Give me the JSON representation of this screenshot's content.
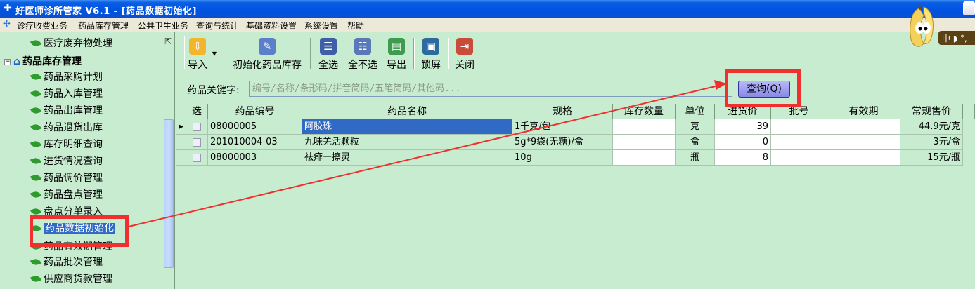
{
  "window": {
    "title": "好医师诊所管家 V6.1 - [药品数据初始化]"
  },
  "menu": {
    "items": [
      "诊疗收费业务",
      "药品库存管理",
      "公共卫生业务",
      "查询与统计",
      "基础资料设置",
      "系统设置",
      "帮助"
    ]
  },
  "ime": {
    "label": "中"
  },
  "sidebar": {
    "group_label": "药品库存管理",
    "items": [
      {
        "label": "医疗废弃物处理"
      },
      {
        "label": "药品采购计划"
      },
      {
        "label": "药品入库管理"
      },
      {
        "label": "药品出库管理"
      },
      {
        "label": "药品退货出库"
      },
      {
        "label": "库存明细查询"
      },
      {
        "label": "进货情况查询"
      },
      {
        "label": "药品调价管理"
      },
      {
        "label": "药品盘点管理"
      },
      {
        "label": "盘点分单录入"
      },
      {
        "label": "药品数据初始化"
      },
      {
        "label": "药品有效期管理"
      },
      {
        "label": "药品批次管理"
      },
      {
        "label": "供应商货款管理"
      }
    ]
  },
  "toolbar": {
    "import_label": "导入",
    "init_label": "初始化药品库存",
    "select_all_label": "全选",
    "select_none_label": "全不选",
    "export_label": "导出",
    "lock_label": "锁屏",
    "close_label": "关闭"
  },
  "search": {
    "label": "药品关键字:",
    "placeholder": "编号/名称/条形码/拼音简码/五笔简码/其他码...",
    "button_label": "查询(Q)"
  },
  "table": {
    "columns": [
      "选",
      "药品编号",
      "药品名称",
      "规格",
      "库存数量",
      "单位",
      "进货价",
      "批号",
      "有效期",
      "常规售价"
    ],
    "rows": [
      {
        "code": "08000005",
        "name": "阿胶珠",
        "spec": "1千克/包",
        "stock": "",
        "unit": "克",
        "price": "39",
        "batch": "",
        "expiry": "",
        "retail": "44.9元/克"
      },
      {
        "code": "201010004-03",
        "name": "九味羌活颗粒",
        "spec": "5g*9袋(无糖)/盒",
        "stock": "",
        "unit": "盒",
        "price": "0",
        "batch": "",
        "expiry": "",
        "retail": "3元/盒"
      },
      {
        "code": "08000003",
        "name": "祛痱一擦灵",
        "spec": "10g",
        "stock": "",
        "unit": "瓶",
        "price": "8",
        "batch": "",
        "expiry": "",
        "retail": "15元/瓶"
      }
    ]
  },
  "colors": {
    "background": "#c8eccf",
    "titlebar": "#0053e0",
    "selection": "#316ac5",
    "annotation": "#f0302e"
  }
}
